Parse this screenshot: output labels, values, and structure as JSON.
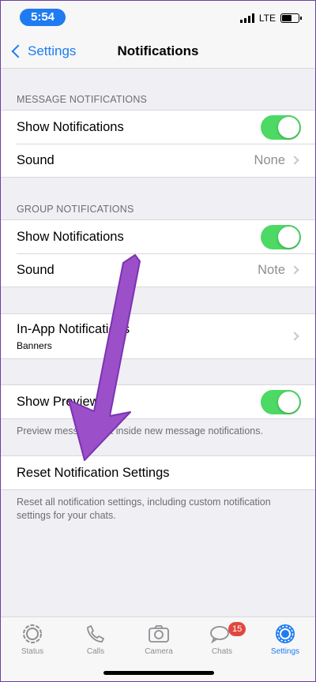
{
  "status": {
    "time": "5:54",
    "network": "LTE"
  },
  "nav": {
    "back_label": "Settings",
    "title": "Notifications"
  },
  "message_notifications": {
    "header": "MESSAGE NOTIFICATIONS",
    "show_label": "Show Notifications",
    "show_enabled": true,
    "sound_label": "Sound",
    "sound_value": "None"
  },
  "group_notifications": {
    "header": "GROUP NOTIFICATIONS",
    "show_label": "Show Notifications",
    "show_enabled": true,
    "sound_label": "Sound",
    "sound_value": "Note"
  },
  "in_app": {
    "label": "In-App Notifications",
    "value": "Banners"
  },
  "preview": {
    "label": "Show Preview",
    "enabled": true,
    "footer": "Preview message text inside new message notifications."
  },
  "reset": {
    "label": "Reset Notification Settings",
    "footer": "Reset all notification settings, including custom notification settings for your chats."
  },
  "tabbar": {
    "items": [
      {
        "label": "Status",
        "icon": "status-icon"
      },
      {
        "label": "Calls",
        "icon": "phone-icon"
      },
      {
        "label": "Camera",
        "icon": "camera-icon"
      },
      {
        "label": "Chats",
        "icon": "chat-bubbles-icon",
        "badge": "15"
      },
      {
        "label": "Settings",
        "icon": "gear-icon",
        "active": true
      }
    ]
  },
  "colors": {
    "accent": "#1e7bf2",
    "toggle_on": "#4cd964",
    "destructive": "#e0483f",
    "annotation_arrow": "#9b4fc9"
  }
}
